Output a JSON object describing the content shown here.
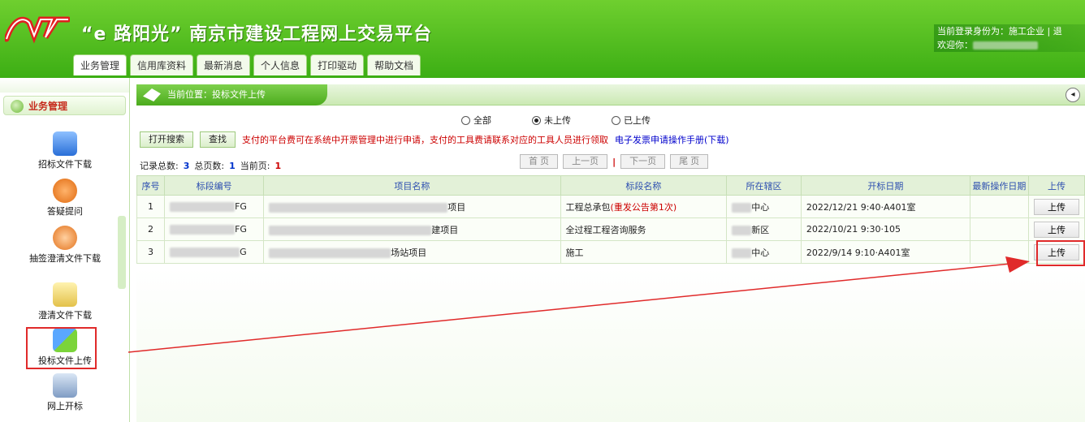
{
  "header": {
    "logo_text": "NJJJ",
    "title": "“e 路阳光” 南京市建设工程网上交易平台",
    "user_role_label": "当前登录身份为：施工企业 | 退",
    "welcome_label": "欢迎你："
  },
  "nav": {
    "tabs": [
      "业务管理",
      "信用库资料",
      "最新消息",
      "个人信息",
      "打印驱动",
      "帮助文档"
    ]
  },
  "sidebar": {
    "title": "业务管理",
    "items": [
      {
        "label": "招标文件下载",
        "icon": "calendar-icon"
      },
      {
        "label": "答疑提问",
        "icon": "question-icon"
      },
      {
        "label": "抽签澄清文件下载",
        "icon": "at-icon"
      },
      {
        "label": "澄清文件下载",
        "icon": "download-icon"
      },
      {
        "label": "投标文件上传",
        "icon": "box-upload-icon"
      },
      {
        "label": "网上开标",
        "icon": "monitor-icon"
      }
    ]
  },
  "breadcrumb": {
    "text": "当前位置：投标文件上传"
  },
  "filters": {
    "options": [
      "全部",
      "未上传",
      "已上传"
    ],
    "selected": "未上传"
  },
  "actions": {
    "open_search": "打开搜索",
    "search": "查找",
    "notice": "支付的平台费可在系统中开票管理中进行申请，支付的工具费请联系对应的工具人员进行领取",
    "manual": "电子发票申请操作手册(下载)"
  },
  "stats": {
    "total_label": "记录总数:",
    "total": "3",
    "pages_label": "总页数:",
    "pages": "1",
    "current_label": "当前页:",
    "current": "1"
  },
  "pager": {
    "first": "首 页",
    "prev": "上一页",
    "sep": "|",
    "next": "下一页",
    "last": "尾 页"
  },
  "table": {
    "headers": [
      "序号",
      "标段编号",
      "项目名称",
      "标段名称",
      "所在辖区",
      "开标日期",
      "最新操作日期",
      "上传"
    ],
    "rows": [
      {
        "no": "1",
        "code_tail": "FG",
        "project_tail": "项目",
        "section": "工程总承包",
        "section_note": "(重发公告第1次)",
        "district_tail": "中心",
        "date": "2022/12/21 9:40·A401室",
        "latest": "",
        "upload": "上传"
      },
      {
        "no": "2",
        "code_tail": "FG",
        "project_tail": "建项目",
        "section": "全过程工程咨询服务",
        "section_note": "",
        "district_tail": "新区",
        "date": "2022/10/21 9:30·105",
        "latest": "",
        "upload": "上传"
      },
      {
        "no": "3",
        "code_tail": "G",
        "project_tail": "场站项目",
        "section": "施工",
        "section_note": "",
        "district_tail": "中心",
        "date": "2022/9/14 9:10·A401室",
        "latest": "",
        "upload": "上传"
      }
    ]
  },
  "colors": {
    "header_green": "#4cb51c",
    "accent_red": "#e02a2a",
    "link_blue": "#0000cc"
  }
}
